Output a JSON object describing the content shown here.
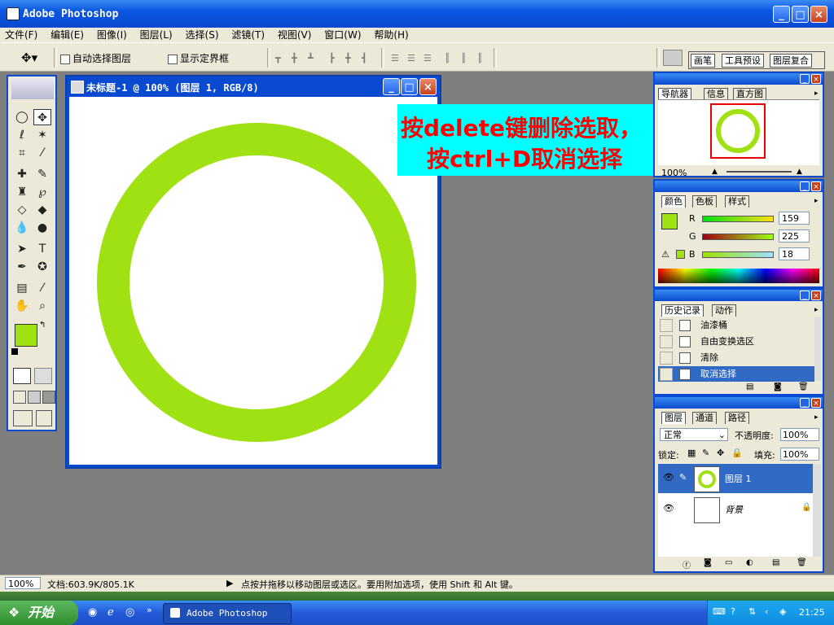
{
  "app": {
    "title": "Adobe Photoshop"
  },
  "menu": [
    "文件(F)",
    "编辑(E)",
    "图像(I)",
    "图层(L)",
    "选择(S)",
    "滤镜(T)",
    "视图(V)",
    "窗口(W)",
    "帮助(H)"
  ],
  "options": {
    "auto_select": "自动选择图层",
    "show_bounds": "显示定界框",
    "tabs": [
      "画笔",
      "工具预设",
      "图层复合"
    ]
  },
  "document": {
    "title": "未标题-1 @ 100% (图层 1, RGB/8)",
    "ring_color": "#9fe112"
  },
  "annotation": {
    "line1": "按delete键删除选取，",
    "line2": "按ctrl+D取消选择",
    "text_color": "#ff0000",
    "bg_color": "#00ffff"
  },
  "navigator": {
    "tabs": [
      "导航器",
      "信息",
      "直方图"
    ],
    "zoom": "100%"
  },
  "color": {
    "tabs": [
      "颜色",
      "色板",
      "样式"
    ],
    "r_label": "R",
    "g_label": "G",
    "b_label": "B",
    "r": "159",
    "g": "225",
    "b": "18",
    "foreground": "#9fe112"
  },
  "history": {
    "tabs": [
      "历史记录",
      "动作"
    ],
    "items": [
      "油漆桶",
      "自由变换选区",
      "清除",
      "取消选择"
    ]
  },
  "layers": {
    "tabs": [
      "图层",
      "通道",
      "路径"
    ],
    "blend_mode": "正常",
    "opacity_label": "不透明度:",
    "opacity": "100%",
    "lock_label": "锁定:",
    "fill_label": "填充:",
    "fill": "100%",
    "items": [
      "图层 1",
      "背景"
    ]
  },
  "status": {
    "zoom": "100%",
    "doc_info": "文档:603.9K/805.1K",
    "hint": "点按并拖移以移动图层或选区。要用附加选项，使用 Shift 和 Alt 键。"
  },
  "taskbar": {
    "start": "开始",
    "task": "Adobe Photoshop",
    "time": "21:25"
  }
}
